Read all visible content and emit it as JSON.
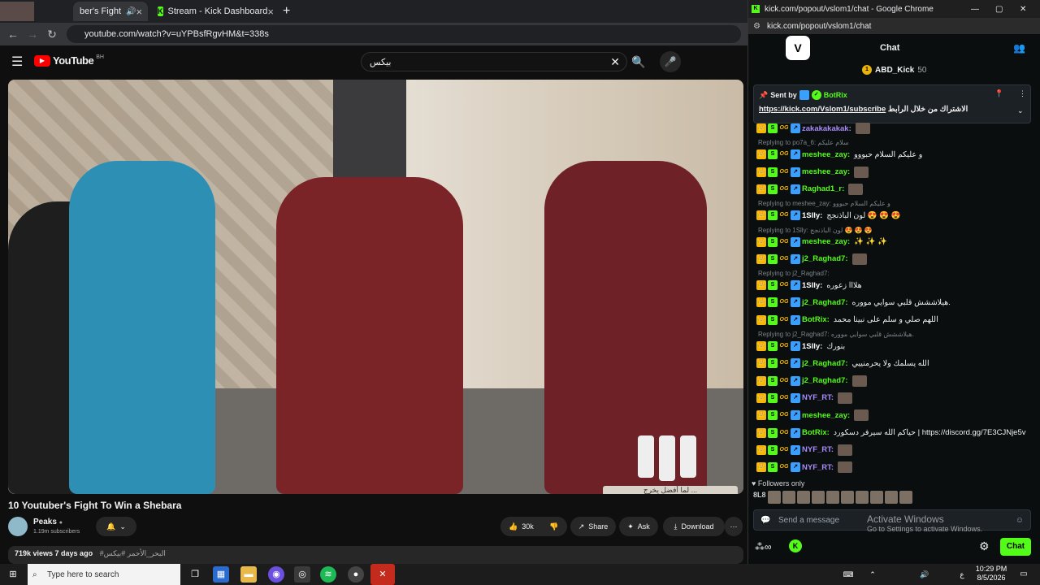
{
  "left_window": {
    "tabs": [
      {
        "label": "ber's Fight"
      },
      {
        "label": "Stream - Kick Dashboard"
      }
    ],
    "url": "youtube.com/watch?v=uYPBsfRgvHM&t=338s",
    "youtube": {
      "logo": "YouTube",
      "region": "BH",
      "search_value": "بيكس"
    },
    "video_caption": "لما أفضل يخرج ...",
    "video_title": "10 Youtuber's Fight To Win a Shebara",
    "channel_name": "Peaks",
    "subscribers": "1.19m subscribers",
    "likes": "30k",
    "share_label": "Share",
    "ask_label": "Ask",
    "download_label": "Download",
    "views_line": "719k views  7 days ago",
    "hashtags": "#البحر_الأحمر #بيكس"
  },
  "right_window": {
    "title": "kick.com/popout/vslom1/chat - Google Chrome",
    "url": "kick.com/popout/vslom1/chat",
    "chat_title": "Chat",
    "top_gifter": "ABD_Kick",
    "top_gifter_count": "50",
    "pinned": {
      "sent_by": "Sent by",
      "sender": "BotRix",
      "link": "https://kick.com/Vslom1/subscribe",
      "text": "الاشتراك من خلال الرابط"
    },
    "messages": [
      {
        "user": "zakakakakak:",
        "text": "",
        "color": "#a78bfa",
        "reply": ""
      },
      {
        "user": "meshee_zay:",
        "text": "و عليكم السلام حبووو",
        "color": "#53fc18",
        "reply": "Replying to po7a_6: سلام عليكم"
      },
      {
        "user": "meshee_zay:",
        "text": "",
        "color": "#53fc18",
        "reply": ""
      },
      {
        "user": "Raghad1_r:",
        "text": "",
        "color": "#53fc18",
        "reply": ""
      },
      {
        "user": "1Slly:",
        "text": "لون الباذنجج 😍 😍 😍",
        "color": "#ffffff",
        "reply": "Replying to meshee_zay: و عليكم السلام حبووو"
      },
      {
        "user": "meshee_zay:",
        "text": "✨ ✨ ✨",
        "color": "#53fc18",
        "reply": "Replying to 1Slly: لون الباذنجج 😍 😍 😍"
      },
      {
        "user": "j2_Raghad7:",
        "text": "",
        "color": "#53fc18",
        "reply": ""
      },
      {
        "user": "1Slly:",
        "text": "هلااا زعوره",
        "color": "#ffffff",
        "reply": "Replying to j2_Raghad7:"
      },
      {
        "user": "j2_Raghad7:",
        "text": "هيلاششش قلبي سوايي مووره.",
        "color": "#53fc18",
        "reply": ""
      },
      {
        "user": "BotRix:",
        "text": "اللهم صلي و سلم على نبينا محمد",
        "color": "#53fc18",
        "reply": ""
      },
      {
        "user": "1Slly:",
        "text": "بنورك",
        "color": "#ffffff",
        "reply": "Replying to j2_Raghad7: هيلاششش قلبي سوايي مووره."
      },
      {
        "user": "j2_Raghad7:",
        "text": "الله يسلمك ولا يحرمنييي",
        "color": "#53fc18",
        "reply": ""
      },
      {
        "user": "j2_Raghad7:",
        "text": "",
        "color": "#53fc18",
        "reply": ""
      },
      {
        "user": "NYF_RT:",
        "text": "",
        "color": "#a78bfa",
        "reply": ""
      },
      {
        "user": "meshee_zay:",
        "text": "",
        "color": "#53fc18",
        "reply": ""
      },
      {
        "user": "BotRix:",
        "text": "حياكم الله سيرفر دسكورد | https://discord.gg/7E3CJNje5v",
        "color": "#53fc18",
        "reply": ""
      },
      {
        "user": "NYF_RT:",
        "text": "",
        "color": "#a78bfa",
        "reply": ""
      },
      {
        "user": "NYF_RT:",
        "text": "",
        "color": "#a78bfa",
        "reply": ""
      }
    ],
    "followers_only": "Followers only",
    "avatar_text": "8L8",
    "send_placeholder": "Send a message",
    "chat_button": "Chat",
    "watermark_title": "Activate Windows",
    "watermark_sub": "Go to Settings to activate Windows."
  },
  "taskbar": {
    "search_placeholder": "Type here to search",
    "time": "10:29 PM",
    "date": "8/5/2026",
    "lang": "ع"
  }
}
